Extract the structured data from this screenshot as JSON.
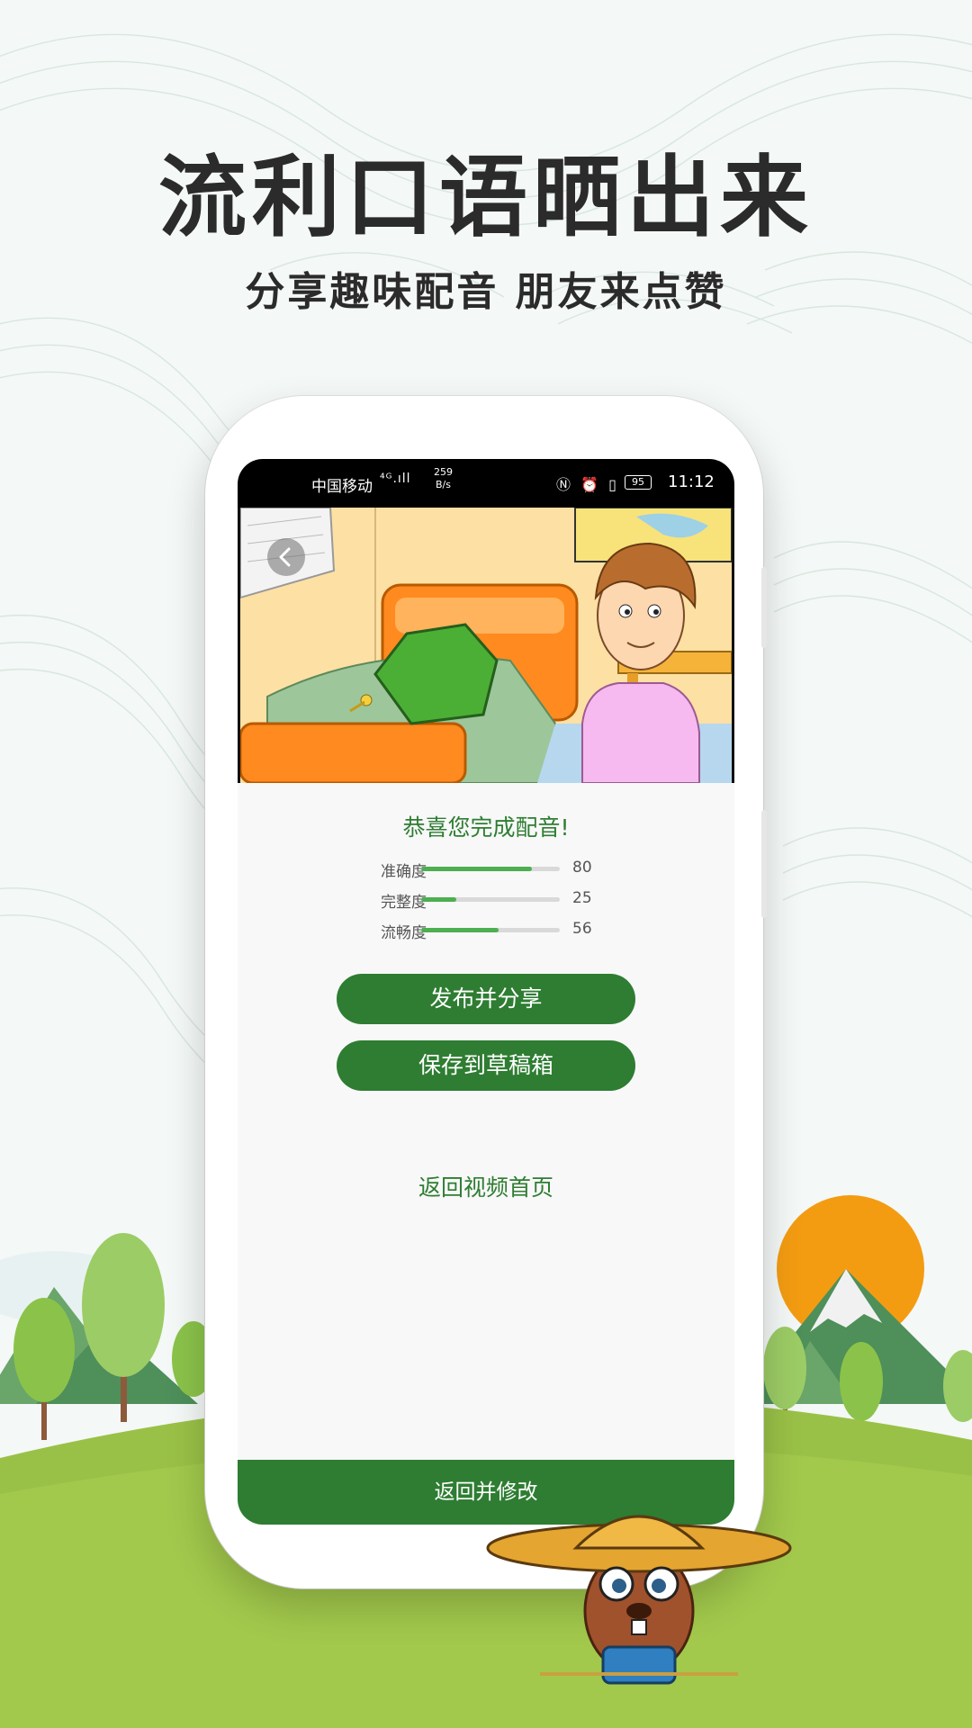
{
  "promo": {
    "title": "流利口语晒出来",
    "subtitle": "分享趣味配音 朋友来点赞"
  },
  "status_bar": {
    "carrier": "中国移动",
    "signal": "⁴ᴳ.ıll",
    "net_speed_value": "259",
    "net_speed_unit": "B/s",
    "right_icons": "Ⓝ ⏰ ▯",
    "battery": "95",
    "time": "11:12"
  },
  "result": {
    "congrats": "恭喜您完成配音!",
    "scores": [
      {
        "label": "准确度",
        "value": 80
      },
      {
        "label": "完整度",
        "value": 25
      },
      {
        "label": "流畅度",
        "value": 56
      }
    ],
    "publish_label": "发布并分享",
    "draft_label": "保存到草稿箱",
    "back_home_label": "返回视频首页",
    "bottom_label": "返回并修改"
  },
  "colors": {
    "brand_green": "#2e7d32",
    "bar_green": "#4caf50",
    "sun": "#f39c12"
  },
  "icons": {
    "back": "chevron-left-icon"
  }
}
